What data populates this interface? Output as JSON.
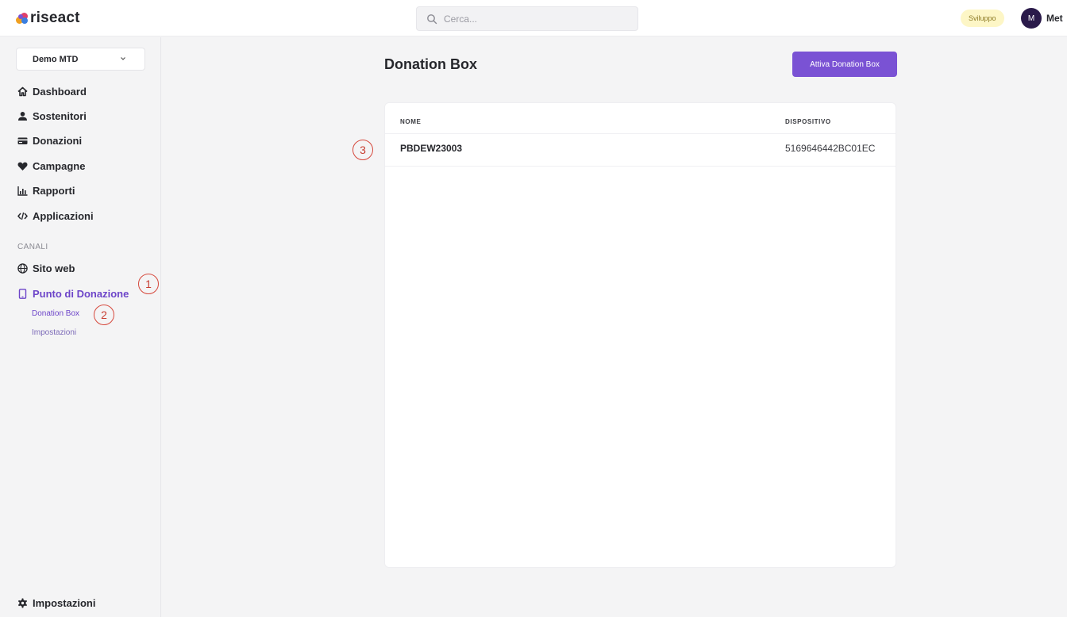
{
  "app": {
    "logo_text": "riseact",
    "brand_color": "#7a52d4"
  },
  "header": {
    "search_placeholder": "Cerca...",
    "search_icon": "search-icon",
    "env_badge": "Sviluppo",
    "avatar_initial": "M",
    "user_name": "Met"
  },
  "sidebar": {
    "org_selector": "Demo MTD",
    "nav": [
      {
        "label": "Dashboard",
        "icon": "home-icon"
      },
      {
        "label": "Sostenitori",
        "icon": "user-icon"
      },
      {
        "label": "Donazioni",
        "icon": "credit-card-icon"
      },
      {
        "label": "Campagne",
        "icon": "heart-icon"
      },
      {
        "label": "Rapporti",
        "icon": "chart-icon"
      },
      {
        "label": "Applicazioni",
        "icon": "code-icon"
      }
    ],
    "channels_label": "CANALI",
    "channels": [
      {
        "label": "Sito web",
        "icon": "globe-icon"
      },
      {
        "label": "Punto di Donazione",
        "icon": "tablet-icon",
        "active": true
      }
    ],
    "sub_items": [
      {
        "label": "Donation Box",
        "active": true
      },
      {
        "label": "Impostazioni",
        "active": false
      }
    ],
    "settings": {
      "label": "Impostazioni",
      "icon": "gear-icon"
    }
  },
  "markers": [
    "1",
    "2",
    "3"
  ],
  "main": {
    "title": "Donation Box",
    "primary_button": "Attiva Donation Box",
    "table": {
      "columns": [
        "NOME",
        "DISPOSITIVO"
      ],
      "rows": [
        {
          "nome": "PBDEW23003",
          "dispositivo": "5169646442BC01EC"
        }
      ]
    }
  }
}
